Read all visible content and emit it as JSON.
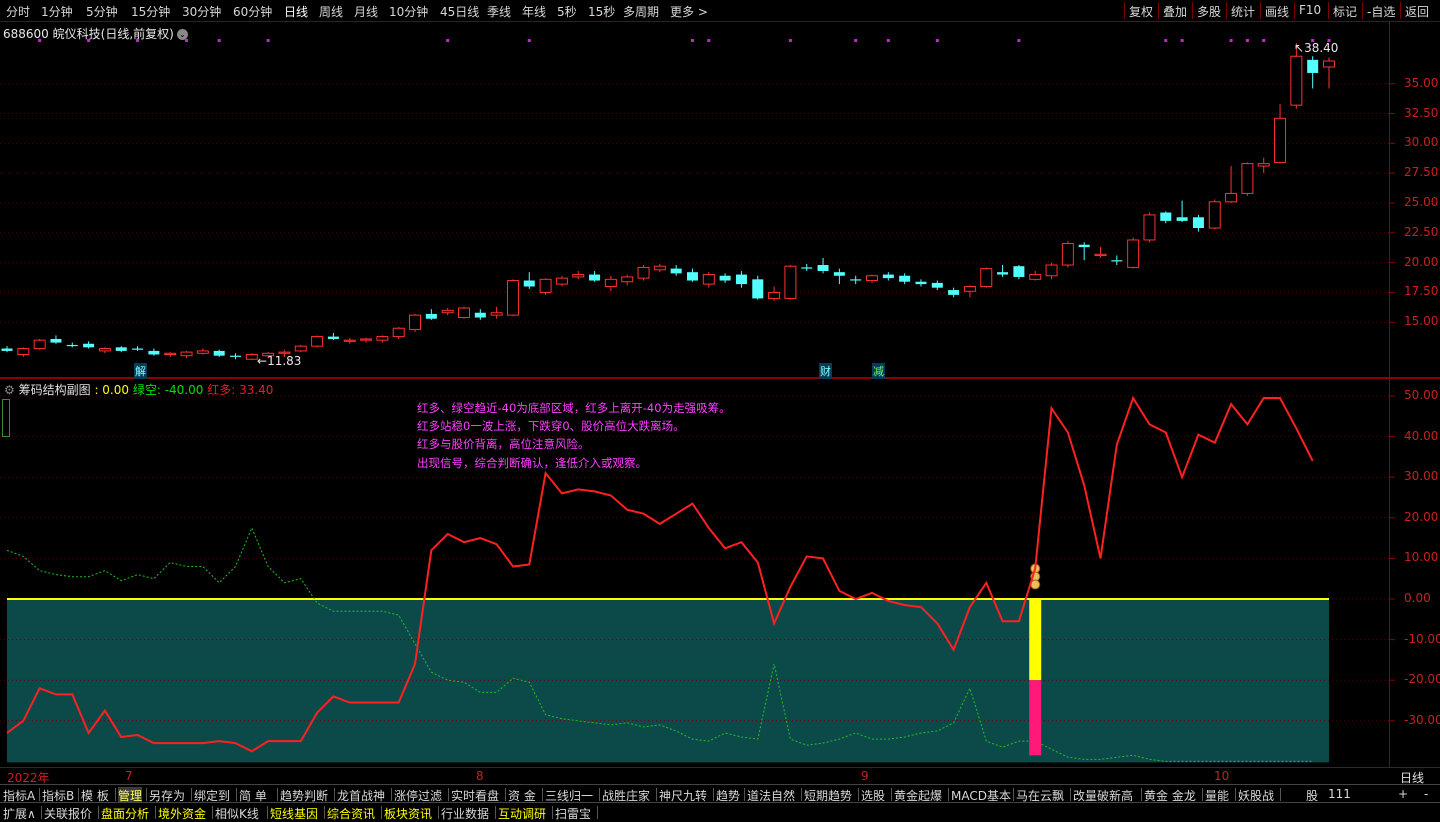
{
  "toolbar": {
    "periods": [
      "分时",
      "1分钟",
      "5分钟",
      "15分钟",
      "30分钟",
      "60分钟",
      "日线",
      "周线",
      "月线",
      "10分钟",
      "45日线",
      "季线",
      "年线",
      "5秒",
      "15秒",
      "多周期",
      "更多 >"
    ],
    "active_period": "日线",
    "right_items": [
      "复权",
      "叠加",
      "多股",
      "统计",
      "画线",
      "F10",
      "标记",
      "-自选",
      "返回"
    ]
  },
  "stock": {
    "code": "688600",
    "name": "皖仪科技",
    "mode": "(日线,前复权)"
  },
  "main_chart": {
    "type": "candlestick",
    "price_axis": [
      "35.00",
      "32.50",
      "30.00",
      "27.50",
      "25.00",
      "22.50",
      "20.00",
      "17.50",
      "15.00"
    ],
    "price_range": [
      11.0,
      39.5
    ],
    "high_label": "38.40",
    "low_label": "11.83",
    "up_color": "#ff3030",
    "down_color": "#54ffff",
    "candles": [
      [
        12.8,
        13.0,
        12.5,
        12.6
      ],
      [
        12.3,
        12.9,
        12.1,
        12.8
      ],
      [
        12.8,
        13.6,
        12.7,
        13.5
      ],
      [
        13.6,
        13.9,
        13.2,
        13.3
      ],
      [
        13.1,
        13.3,
        12.9,
        13.0
      ],
      [
        13.2,
        13.4,
        12.8,
        12.9
      ],
      [
        12.6,
        12.9,
        12.4,
        12.8
      ],
      [
        12.9,
        13.0,
        12.5,
        12.6
      ],
      [
        12.8,
        13.0,
        12.6,
        12.7
      ],
      [
        12.6,
        12.8,
        12.2,
        12.3
      ],
      [
        12.3,
        12.5,
        12.1,
        12.4
      ],
      [
        12.2,
        12.6,
        12.0,
        12.5
      ],
      [
        12.4,
        12.8,
        12.3,
        12.6
      ],
      [
        12.6,
        12.7,
        12.1,
        12.2
      ],
      [
        12.2,
        12.4,
        11.9,
        12.1
      ],
      [
        11.9,
        12.4,
        11.83,
        12.3
      ],
      [
        12.2,
        12.5,
        12.0,
        12.4
      ],
      [
        12.4,
        12.7,
        12.1,
        12.5
      ],
      [
        12.6,
        13.1,
        12.5,
        13.0
      ],
      [
        13.0,
        13.9,
        12.9,
        13.8
      ],
      [
        13.8,
        14.1,
        13.5,
        13.6
      ],
      [
        13.4,
        13.7,
        13.2,
        13.5
      ],
      [
        13.5,
        13.7,
        13.3,
        13.6
      ],
      [
        13.5,
        13.9,
        13.3,
        13.8
      ],
      [
        13.8,
        14.6,
        13.6,
        14.5
      ],
      [
        14.4,
        15.7,
        14.2,
        15.6
      ],
      [
        15.7,
        16.1,
        15.2,
        15.3
      ],
      [
        15.8,
        16.2,
        15.6,
        16.0
      ],
      [
        15.4,
        16.3,
        15.3,
        16.2
      ],
      [
        15.8,
        16.1,
        15.2,
        15.4
      ],
      [
        15.6,
        16.3,
        15.3,
        15.8
      ],
      [
        15.6,
        18.6,
        15.5,
        18.5
      ],
      [
        18.5,
        19.2,
        17.8,
        18.0
      ],
      [
        17.5,
        18.7,
        17.3,
        18.6
      ],
      [
        18.2,
        18.9,
        18.0,
        18.7
      ],
      [
        18.8,
        19.3,
        18.6,
        19.0
      ],
      [
        19.0,
        19.3,
        18.4,
        18.5
      ],
      [
        18.0,
        18.9,
        17.6,
        18.6
      ],
      [
        18.4,
        19.0,
        18.1,
        18.8
      ],
      [
        18.7,
        19.8,
        18.5,
        19.6
      ],
      [
        19.4,
        19.9,
        19.2,
        19.7
      ],
      [
        19.5,
        19.8,
        18.9,
        19.1
      ],
      [
        19.2,
        19.5,
        18.4,
        18.5
      ],
      [
        18.2,
        19.2,
        17.9,
        19.0
      ],
      [
        18.9,
        19.1,
        18.3,
        18.5
      ],
      [
        19.0,
        19.3,
        17.9,
        18.2
      ],
      [
        18.6,
        18.9,
        16.9,
        17.0
      ],
      [
        17.0,
        18.0,
        16.8,
        17.5
      ],
      [
        17.0,
        19.8,
        16.9,
        19.7
      ],
      [
        19.6,
        19.9,
        19.3,
        19.5
      ],
      [
        19.8,
        20.4,
        19.1,
        19.3
      ],
      [
        19.2,
        19.5,
        18.2,
        18.9
      ],
      [
        18.6,
        18.9,
        18.2,
        18.5
      ],
      [
        18.5,
        19.0,
        18.3,
        18.9
      ],
      [
        19.0,
        19.2,
        18.5,
        18.7
      ],
      [
        18.9,
        19.1,
        18.2,
        18.4
      ],
      [
        18.4,
        18.6,
        18.0,
        18.2
      ],
      [
        18.3,
        18.5,
        17.7,
        17.9
      ],
      [
        17.7,
        17.9,
        17.1,
        17.3
      ],
      [
        17.6,
        18.1,
        17.1,
        18.0
      ],
      [
        18.0,
        19.6,
        17.9,
        19.5
      ],
      [
        19.2,
        19.8,
        18.8,
        19.0
      ],
      [
        19.7,
        19.8,
        18.6,
        18.8
      ],
      [
        18.6,
        19.3,
        18.5,
        19.0
      ],
      [
        18.9,
        20.0,
        18.6,
        19.8
      ],
      [
        19.8,
        21.8,
        19.6,
        21.6
      ],
      [
        21.5,
        21.7,
        20.2,
        21.3
      ],
      [
        20.6,
        21.3,
        20.4,
        20.7
      ],
      [
        20.2,
        20.6,
        19.8,
        20.1
      ],
      [
        19.6,
        22.1,
        19.5,
        21.9
      ],
      [
        21.9,
        24.2,
        21.7,
        24.0
      ],
      [
        24.2,
        24.3,
        23.3,
        23.5
      ],
      [
        23.8,
        25.2,
        23.4,
        23.5
      ],
      [
        23.8,
        24.0,
        22.6,
        22.9
      ],
      [
        22.9,
        25.3,
        22.8,
        25.1
      ],
      [
        25.1,
        28.1,
        25.0,
        25.8
      ],
      [
        25.8,
        28.4,
        25.6,
        28.3
      ],
      [
        28.1,
        28.8,
        27.5,
        28.3
      ],
      [
        28.4,
        33.3,
        28.3,
        32.1
      ],
      [
        33.2,
        38.4,
        32.9,
        37.3
      ],
      [
        37.0,
        37.3,
        34.6,
        35.9
      ],
      [
        36.4,
        37.2,
        34.6,
        36.9
      ]
    ],
    "magenta_dot_indices": [
      2,
      5,
      8,
      11,
      13,
      16,
      27,
      32,
      42,
      43,
      48,
      52,
      54,
      57,
      62,
      71,
      72,
      75,
      76,
      77,
      80,
      81
    ]
  },
  "events": [
    {
      "label": "解",
      "style": "cyan"
    },
    {
      "label": "财",
      "style": "cyan"
    },
    {
      "label": "减",
      "style": "green"
    }
  ],
  "indicator": {
    "name": "筹码结构副图",
    "v0_text": ": 0.00",
    "green_text": "绿空: -40.00",
    "red_text": "红多: 33.40",
    "axis": [
      "50.00",
      "40.00",
      "30.00",
      "20.00",
      "10.00",
      "0.00",
      "-10.00",
      "-20.00",
      "-30.00"
    ],
    "y_range": [
      -40.5,
      52.5
    ],
    "notes": [
      "红多、绿空趋近-40为底部区域，红多上离开-40为走强吸筹。",
      "红多站稳0一波上涨，下跌穿0、股价高位大跌离场。",
      "红多与股价背离，高位注意风险。",
      "出现信号，综合判断确认，逢低介入或观察。"
    ],
    "red_series": [
      -33,
      -30,
      -22,
      -23.5,
      -23.5,
      -33,
      -27.5,
      -34,
      -33.5,
      -35.5,
      -35.5,
      -35.5,
      -35.5,
      -35,
      -35.5,
      -37.5,
      -35,
      -35,
      -35,
      -28,
      -24,
      -25.5,
      -25.5,
      -25.5,
      -25.5,
      -16,
      12,
      16,
      14,
      15,
      13.5,
      8,
      8.5,
      31,
      26,
      27,
      26.5,
      25.5,
      22,
      21,
      18.5,
      21,
      23.5,
      17.5,
      12.5,
      14,
      9,
      -6,
      3,
      10.5,
      10,
      2,
      0,
      1.5,
      -0.5,
      -1.5,
      -2,
      -6,
      -12.5,
      -2,
      4,
      -5.5,
      -5.5,
      7.5,
      47,
      41,
      28,
      10,
      38,
      49.5,
      43,
      41,
      30,
      40.5,
      38.5,
      48,
      43,
      49.5,
      49.5,
      42,
      34
    ],
    "green_series": [
      12,
      10.5,
      7,
      6,
      5.5,
      5.5,
      7,
      4.5,
      6,
      5,
      9,
      8,
      8,
      4,
      8,
      17.5,
      8,
      4,
      5,
      -1,
      -3,
      -3,
      -3,
      -3,
      -4,
      -11,
      -18,
      -20,
      -20.5,
      -23,
      -23,
      -19.5,
      -20.5,
      -28.5,
      -29.5,
      -30,
      -30.5,
      -31,
      -30.5,
      -31.5,
      -31,
      -32.5,
      -34.5,
      -35,
      -33,
      -34,
      -34.5,
      -16,
      -34.5,
      -36,
      -35.5,
      -34.5,
      -33,
      -34.5,
      -34.5,
      -34,
      -33,
      -32.5,
      -30.5,
      -22,
      -35,
      -36.5,
      -35,
      -35,
      -37,
      -39,
      -39.5,
      -39.5,
      -39,
      -38.5,
      -39.5,
      -40,
      -40,
      -40,
      -40,
      -40,
      -40,
      -40,
      -40,
      -40,
      -40
    ],
    "signal_index": 63
  },
  "dates": [
    "2022年",
    "7",
    "8",
    "9",
    "10"
  ],
  "period_label": "日线",
  "bottom_row1": [
    {
      "label": "指标A"
    },
    {
      "label": "指标B"
    },
    {
      "label": "模 板"
    },
    {
      "label": "管理",
      "sel": true
    },
    {
      "label": "另存为"
    },
    {
      "label": "绑定到"
    },
    {
      "label": "简 单"
    },
    {
      "label": "趋势判断"
    },
    {
      "label": "龙首战神"
    },
    {
      "label": "涨停过滤"
    },
    {
      "label": "实时看盘"
    },
    {
      "label": "资 金"
    },
    {
      "label": "三线归一"
    },
    {
      "label": "战胜庄家"
    },
    {
      "label": "神尺九转"
    },
    {
      "label": "趋势"
    },
    {
      "label": "道法自然"
    },
    {
      "label": "短期趋势"
    },
    {
      "label": "选股"
    },
    {
      "label": "黄金起爆"
    },
    {
      "label": "MACD基本"
    },
    {
      "label": "马在云飘"
    },
    {
      "label": "改量破新高"
    },
    {
      "label": "黄金 金龙"
    },
    {
      "label": "量能"
    },
    {
      "label": "妖股战"
    }
  ],
  "bottom_row1_right": [
    "股",
    "111",
    "+",
    "-"
  ],
  "bottom_row2": [
    {
      "label": "扩展∧",
      "color": "#d8d8d8"
    },
    {
      "label": "关联报价",
      "color": "#d8d8d8"
    },
    {
      "label": "盘面分析",
      "color": "#ffff00"
    },
    {
      "label": "境外资金",
      "color": "#ffff00"
    },
    {
      "label": "相似K线",
      "color": "#d8d8d8"
    },
    {
      "label": "短线基因",
      "color": "#ffff00"
    },
    {
      "label": "综合资讯",
      "color": "#ffff00"
    },
    {
      "label": "板块资讯",
      "color": "#ffff00"
    },
    {
      "label": "行业数据",
      "color": "#d8d8d8"
    },
    {
      "label": "互动调研",
      "color": "#ffff00"
    },
    {
      "label": "扫雷宝",
      "color": "#d8d8d8"
    }
  ]
}
